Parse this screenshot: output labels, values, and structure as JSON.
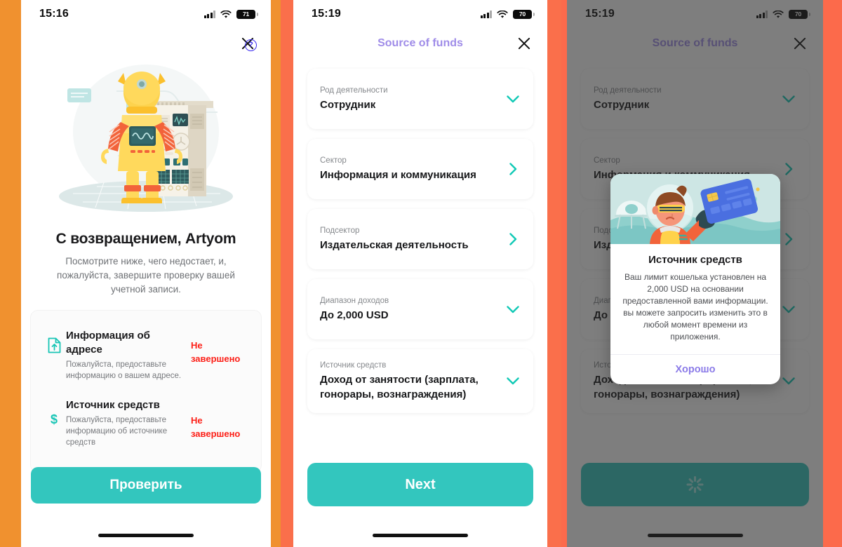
{
  "theme": {
    "accent_teal": "#33C6BE",
    "accent_purple": "#9F8CE8",
    "error_red": "#FC1F17",
    "band_left": "#F0912F",
    "band_mid": "#FA6F4B",
    "band_right": "#FC6A4B"
  },
  "panel1": {
    "status": {
      "time": "15:16",
      "battery": "71",
      "signal_icon": "cellular-signal-icon",
      "wifi_icon": "wifi-icon",
      "battery_icon": "battery-icon"
    },
    "close_icon": "close-icon",
    "help_icon": "help-circle-icon",
    "help_label": "?",
    "illustration": "robot-machine-illustration",
    "title": "С возвращением, Artyom",
    "subtitle": "Посмотрите ниже, чего недостает, и, пожалуйста, завершите проверку вашей учетной записи.",
    "checklist": [
      {
        "icon": "document-upload-icon",
        "title": "Информация об адресе",
        "description": "Пожалуйста, предоставьте информацию о вашем адресе.",
        "status": "Не завершено"
      },
      {
        "icon": "dollar-sign-icon",
        "title": "Источник средств",
        "description": "Пожалуйста, предоставьте информацию об источнике средств",
        "status": "Не завершено"
      }
    ],
    "primary_button": "Проверить"
  },
  "panel2": {
    "status": {
      "time": "15:19",
      "battery": "70",
      "signal_icon": "cellular-signal-icon",
      "wifi_icon": "wifi-icon",
      "battery_icon": "battery-icon"
    },
    "nav_title": "Source of funds",
    "close_icon": "close-icon",
    "fields": [
      {
        "label": "Род деятельности",
        "value": "Сотрудник",
        "chevron": "chevron-down-icon"
      },
      {
        "label": "Сектор",
        "value": "Информация и коммуникация",
        "chevron": "chevron-right-icon"
      },
      {
        "label": "Подсектор",
        "value": "Издательская деятельность",
        "chevron": "chevron-right-icon"
      },
      {
        "label": "Диапазон доходов",
        "value": "До 2,000 USD",
        "chevron": "chevron-down-icon"
      },
      {
        "label": "Источник средств",
        "value": "Доход от занятости (зарплата, гонорары, вознаграждения)",
        "chevron": "chevron-down-icon"
      }
    ],
    "next_button": "Next"
  },
  "panel3": {
    "status": {
      "time": "15:19",
      "battery": "70",
      "signal_icon": "cellular-signal-icon",
      "wifi_icon": "wifi-icon",
      "battery_icon": "battery-icon"
    },
    "nav_title": "Source of funds",
    "close_icon": "close-icon",
    "fields": [
      {
        "label": "Род деятельности",
        "value": "Сотрудник",
        "chevron": "chevron-down-icon"
      },
      {
        "label": "Сектор",
        "value": "Информация и коммуникация",
        "chevron": "chevron-right-icon"
      },
      {
        "label": "Подсектор",
        "value": "Издательская деятельность",
        "chevron": "chevron-right-icon"
      },
      {
        "label": "Диапазон доходов",
        "value": "До 2,000 USD",
        "chevron": "chevron-down-icon"
      },
      {
        "label": "Источник средств",
        "value": "Доход от занятости (зарплата, гонорары, вознаграждения)",
        "chevron": "chevron-down-icon"
      }
    ],
    "next_button_state": "loading-spinner",
    "modal": {
      "illustration": "astronaut-with-credit-card-illustration",
      "title": "Источник средств",
      "text": "Ваш лимит кошелька установлен на 2,000 USD на основании предоставленной вами информации. вы можете запросить изменить это в любой момент времени из приложения.",
      "ok_button": "Хорошо"
    }
  }
}
